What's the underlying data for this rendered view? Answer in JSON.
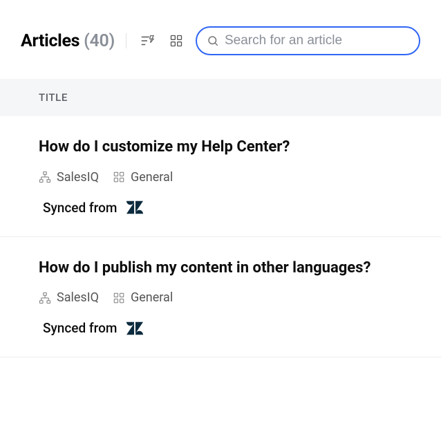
{
  "header": {
    "title_prefix": "Articles",
    "count_display": "(40)"
  },
  "search": {
    "placeholder": "Search for an article"
  },
  "columns": {
    "title_header": "TITLE"
  },
  "articles": [
    {
      "title": "How do I customize my Help Center?",
      "department": "SalesIQ",
      "category": "General",
      "synced_label": "Synced from",
      "synced_source_icon": "zendesk"
    },
    {
      "title": "How do I publish my content in other languages?",
      "department": "SalesIQ",
      "category": "General",
      "synced_label": "Synced from",
      "synced_source_icon": "zendesk"
    }
  ]
}
